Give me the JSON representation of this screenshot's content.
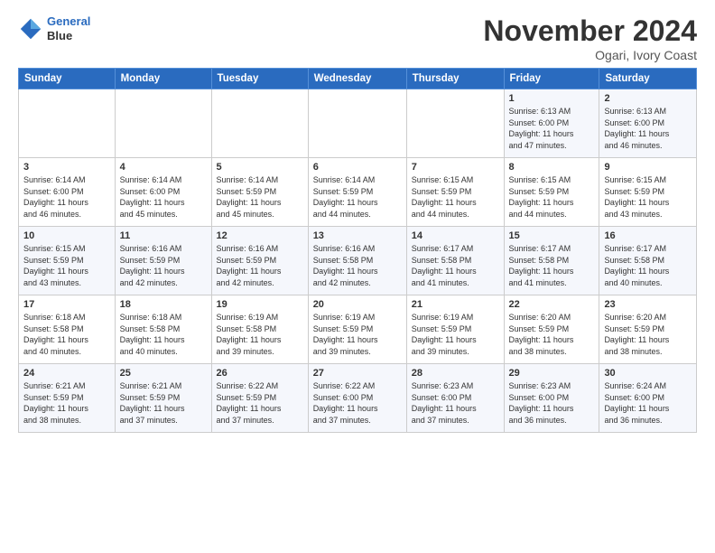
{
  "logo": {
    "line1": "General",
    "line2": "Blue"
  },
  "title": "November 2024",
  "location": "Ogari, Ivory Coast",
  "days_of_week": [
    "Sunday",
    "Monday",
    "Tuesday",
    "Wednesday",
    "Thursday",
    "Friday",
    "Saturday"
  ],
  "weeks": [
    [
      {
        "day": "",
        "info": ""
      },
      {
        "day": "",
        "info": ""
      },
      {
        "day": "",
        "info": ""
      },
      {
        "day": "",
        "info": ""
      },
      {
        "day": "",
        "info": ""
      },
      {
        "day": "1",
        "info": "Sunrise: 6:13 AM\nSunset: 6:00 PM\nDaylight: 11 hours\nand 47 minutes."
      },
      {
        "day": "2",
        "info": "Sunrise: 6:13 AM\nSunset: 6:00 PM\nDaylight: 11 hours\nand 46 minutes."
      }
    ],
    [
      {
        "day": "3",
        "info": "Sunrise: 6:14 AM\nSunset: 6:00 PM\nDaylight: 11 hours\nand 46 minutes."
      },
      {
        "day": "4",
        "info": "Sunrise: 6:14 AM\nSunset: 6:00 PM\nDaylight: 11 hours\nand 45 minutes."
      },
      {
        "day": "5",
        "info": "Sunrise: 6:14 AM\nSunset: 5:59 PM\nDaylight: 11 hours\nand 45 minutes."
      },
      {
        "day": "6",
        "info": "Sunrise: 6:14 AM\nSunset: 5:59 PM\nDaylight: 11 hours\nand 44 minutes."
      },
      {
        "day": "7",
        "info": "Sunrise: 6:15 AM\nSunset: 5:59 PM\nDaylight: 11 hours\nand 44 minutes."
      },
      {
        "day": "8",
        "info": "Sunrise: 6:15 AM\nSunset: 5:59 PM\nDaylight: 11 hours\nand 44 minutes."
      },
      {
        "day": "9",
        "info": "Sunrise: 6:15 AM\nSunset: 5:59 PM\nDaylight: 11 hours\nand 43 minutes."
      }
    ],
    [
      {
        "day": "10",
        "info": "Sunrise: 6:15 AM\nSunset: 5:59 PM\nDaylight: 11 hours\nand 43 minutes."
      },
      {
        "day": "11",
        "info": "Sunrise: 6:16 AM\nSunset: 5:59 PM\nDaylight: 11 hours\nand 42 minutes."
      },
      {
        "day": "12",
        "info": "Sunrise: 6:16 AM\nSunset: 5:59 PM\nDaylight: 11 hours\nand 42 minutes."
      },
      {
        "day": "13",
        "info": "Sunrise: 6:16 AM\nSunset: 5:58 PM\nDaylight: 11 hours\nand 42 minutes."
      },
      {
        "day": "14",
        "info": "Sunrise: 6:17 AM\nSunset: 5:58 PM\nDaylight: 11 hours\nand 41 minutes."
      },
      {
        "day": "15",
        "info": "Sunrise: 6:17 AM\nSunset: 5:58 PM\nDaylight: 11 hours\nand 41 minutes."
      },
      {
        "day": "16",
        "info": "Sunrise: 6:17 AM\nSunset: 5:58 PM\nDaylight: 11 hours\nand 40 minutes."
      }
    ],
    [
      {
        "day": "17",
        "info": "Sunrise: 6:18 AM\nSunset: 5:58 PM\nDaylight: 11 hours\nand 40 minutes."
      },
      {
        "day": "18",
        "info": "Sunrise: 6:18 AM\nSunset: 5:58 PM\nDaylight: 11 hours\nand 40 minutes."
      },
      {
        "day": "19",
        "info": "Sunrise: 6:19 AM\nSunset: 5:58 PM\nDaylight: 11 hours\nand 39 minutes."
      },
      {
        "day": "20",
        "info": "Sunrise: 6:19 AM\nSunset: 5:59 PM\nDaylight: 11 hours\nand 39 minutes."
      },
      {
        "day": "21",
        "info": "Sunrise: 6:19 AM\nSunset: 5:59 PM\nDaylight: 11 hours\nand 39 minutes."
      },
      {
        "day": "22",
        "info": "Sunrise: 6:20 AM\nSunset: 5:59 PM\nDaylight: 11 hours\nand 38 minutes."
      },
      {
        "day": "23",
        "info": "Sunrise: 6:20 AM\nSunset: 5:59 PM\nDaylight: 11 hours\nand 38 minutes."
      }
    ],
    [
      {
        "day": "24",
        "info": "Sunrise: 6:21 AM\nSunset: 5:59 PM\nDaylight: 11 hours\nand 38 minutes."
      },
      {
        "day": "25",
        "info": "Sunrise: 6:21 AM\nSunset: 5:59 PM\nDaylight: 11 hours\nand 37 minutes."
      },
      {
        "day": "26",
        "info": "Sunrise: 6:22 AM\nSunset: 5:59 PM\nDaylight: 11 hours\nand 37 minutes."
      },
      {
        "day": "27",
        "info": "Sunrise: 6:22 AM\nSunset: 6:00 PM\nDaylight: 11 hours\nand 37 minutes."
      },
      {
        "day": "28",
        "info": "Sunrise: 6:23 AM\nSunset: 6:00 PM\nDaylight: 11 hours\nand 37 minutes."
      },
      {
        "day": "29",
        "info": "Sunrise: 6:23 AM\nSunset: 6:00 PM\nDaylight: 11 hours\nand 36 minutes."
      },
      {
        "day": "30",
        "info": "Sunrise: 6:24 AM\nSunset: 6:00 PM\nDaylight: 11 hours\nand 36 minutes."
      }
    ]
  ]
}
